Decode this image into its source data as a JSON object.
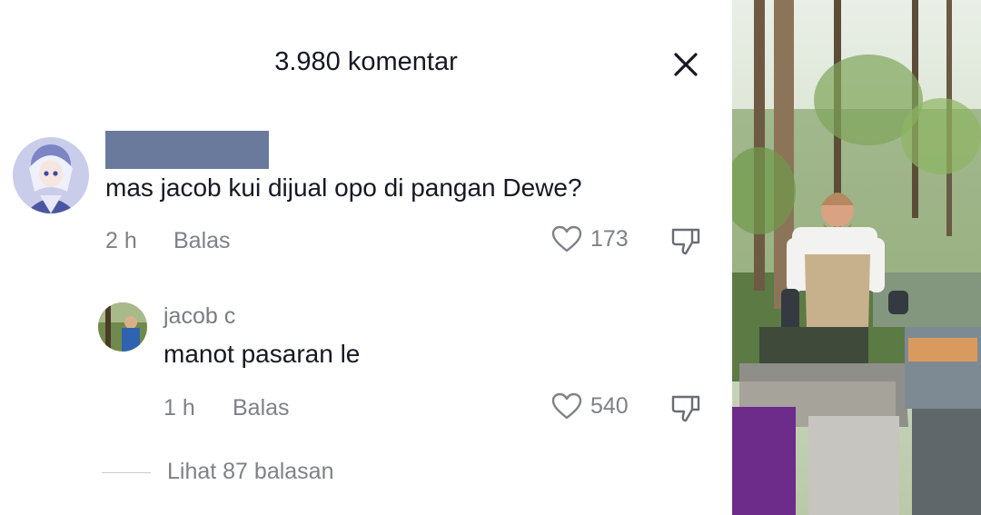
{
  "header": {
    "title": "3.980 komentar",
    "close_icon": "close-icon"
  },
  "comment": {
    "text": "mas jacob kui dijual opo di pangan Dewe?",
    "time": "2 h",
    "reply_label": "Balas",
    "likes": "173"
  },
  "reply": {
    "username": "jacob c",
    "text": "manot pasaran le",
    "time": "1 h",
    "reply_label": "Balas",
    "likes": "540"
  },
  "view_replies": "Lihat 87 balasan",
  "colors": {
    "text": "#161823",
    "secondary": "#7f8188",
    "redaction": "#6a7a9c"
  }
}
